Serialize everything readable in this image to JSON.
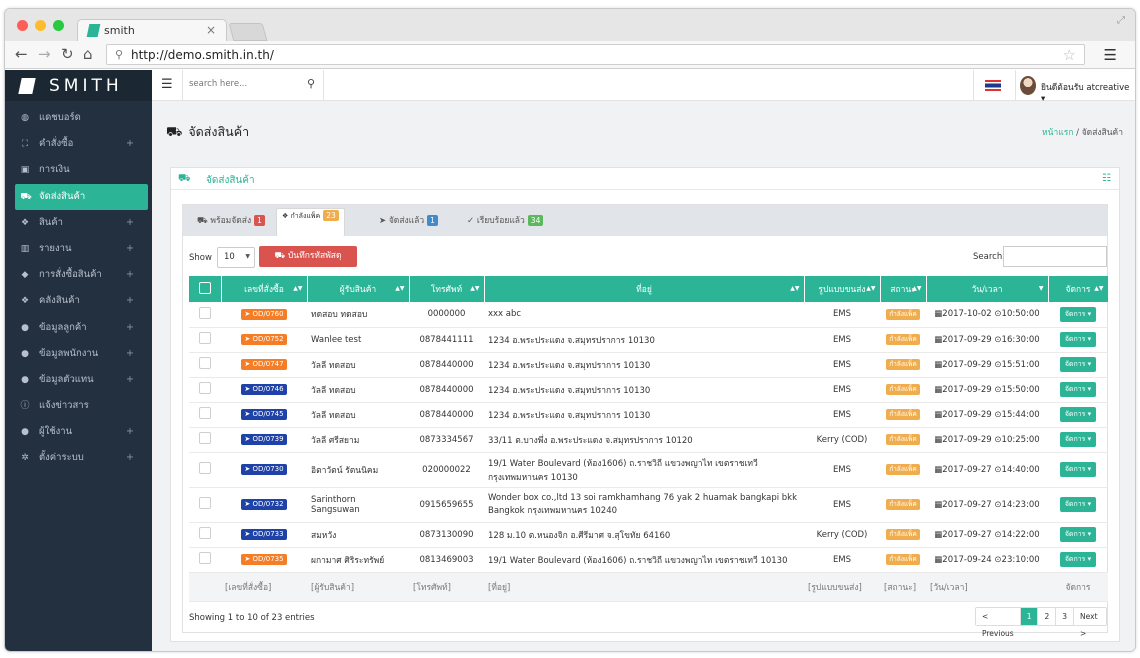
{
  "browser": {
    "tab_title": "smith",
    "tab_close": "×",
    "url": "http://demo.smith.in.th/"
  },
  "sidebar": {
    "brand": "SMITH",
    "items": [
      {
        "label": "แดชบอร์ด",
        "icon": "dashboard-icon",
        "plus": false
      },
      {
        "label": "คำสั่งซื้อ",
        "icon": "cart-icon",
        "plus": true
      },
      {
        "label": "การเงิน",
        "icon": "money-icon",
        "plus": false
      },
      {
        "label": "จัดส่งสินค้า",
        "icon": "truck-icon",
        "plus": false,
        "active": true
      },
      {
        "label": "สินค้า",
        "icon": "cubes-icon",
        "plus": true
      },
      {
        "label": "รายงาน",
        "icon": "chart-icon",
        "plus": true
      },
      {
        "label": "การสั่งซื้อสินค้า",
        "icon": "tag-icon",
        "plus": true
      },
      {
        "label": "คลังสินค้า",
        "icon": "cubes-icon",
        "plus": true
      },
      {
        "label": "ข้อมูลลูกค้า",
        "icon": "users-icon",
        "plus": true
      },
      {
        "label": "ข้อมูลพนักงาน",
        "icon": "users-icon",
        "plus": true
      },
      {
        "label": "ข้อมูลตัวแทน",
        "icon": "users-icon",
        "plus": true
      },
      {
        "label": "แจ้งข่าวสาร",
        "icon": "info-icon",
        "plus": false
      },
      {
        "label": "ผู้ใช้งาน",
        "icon": "users-icon",
        "plus": true
      },
      {
        "label": "ตั้งค่าระบบ",
        "icon": "gear-icon",
        "plus": true
      }
    ]
  },
  "topbar": {
    "search_placeholder": "search here...",
    "user_name": "ยินดีต้อนรับ atcreative"
  },
  "page": {
    "title": "จัดส่งสินค้า",
    "breadcrumb_home": "หน้าแรก",
    "breadcrumb_sep": "/",
    "breadcrumb_current": "จัดส่งสินค้า",
    "panel_title": "จัดส่งสินค้า"
  },
  "tabs": [
    {
      "label": "พร้อมจัดส่ง",
      "count": "1",
      "color": "#d9534f"
    },
    {
      "label": "กำลังแพ็ค",
      "count": "23",
      "color": "#f0ad4e"
    },
    {
      "label": "จัดส่งแล้ว",
      "count": "1",
      "color": "#428bca"
    },
    {
      "label": "เรียบร้อยแล้ว",
      "count": "34",
      "color": "#5cb85c"
    }
  ],
  "controls": {
    "show_label": "Show",
    "page_size": "10",
    "record_button": "บันทึกรหัสพัสดุ",
    "search_label": "Search"
  },
  "table": {
    "headers": [
      "เลขที่สั่งซื้อ",
      "ผู้รับสินค้า",
      "โทรศัพท์",
      "ที่อยู่",
      "รูปแบบขนส่ง",
      "สถานะ",
      "วัน/เวลา",
      "จัดการ"
    ],
    "rows": [
      {
        "order": "OD/0760",
        "c": "o",
        "recipient": "ทดสอบ ทดสอบ",
        "phone": "0000000",
        "address": "xxx abc",
        "ship": "EMS",
        "status": "กำลังแพ็ค",
        "date": "2017-10-02",
        "time": "10:50:00"
      },
      {
        "order": "OD/0752",
        "c": "o",
        "recipient": "Wanlee test",
        "phone": "0878441111",
        "address": "1234 อ.พระประแดง จ.สมุทรปราการ 10130",
        "ship": "EMS",
        "status": "กำลังแพ็ค",
        "date": "2017-09-29",
        "time": "16:30:00"
      },
      {
        "order": "OD/0747",
        "c": "o",
        "recipient": "วัลลี ทดสอบ",
        "phone": "0878440000",
        "address": "1234 อ.พระประแดง จ.สมุทปราการ 10130",
        "ship": "EMS",
        "status": "กำลังแพ็ค",
        "date": "2017-09-29",
        "time": "15:51:00"
      },
      {
        "order": "OD/0746",
        "c": "b",
        "recipient": "วัลลี ทดสอบ",
        "phone": "0878440000",
        "address": "1234 อ.พระประแดง จ.สมุทปราการ 10130",
        "ship": "EMS",
        "status": "กำลังแพ็ค",
        "date": "2017-09-29",
        "time": "15:50:00"
      },
      {
        "order": "OD/0745",
        "c": "b",
        "recipient": "วัลลี ทดสอบ",
        "phone": "0878440000",
        "address": "1234 อ.พระประแดง จ.สมุทปราการ 10130",
        "ship": "EMS",
        "status": "กำลังแพ็ค",
        "date": "2017-09-29",
        "time": "15:44:00"
      },
      {
        "order": "OD/0739",
        "c": "b",
        "recipient": "วัลลี ศรีสยาม",
        "phone": "0873334567",
        "address": "33/11 ต.บางพึ่ง อ.พระประแดง จ.สมุทรปราการ 10120",
        "ship": "Kerry (COD)",
        "status": "กำลังแพ็ค",
        "date": "2017-09-29",
        "time": "10:25:00"
      },
      {
        "order": "OD/0730",
        "c": "b",
        "recipient": "อิตาวัตน์ รัตนนิคม",
        "phone": "020000022",
        "address": "19/1 Water Boulevard (ห้อง1606) ถ.ราชวิถี แขวงพญาไท เขตราชเทวี กรุงเทพมหานคร 10130",
        "ship": "EMS",
        "status": "กำลังแพ็ค",
        "date": "2017-09-27",
        "time": "14:40:00",
        "tall": true
      },
      {
        "order": "OD/0732",
        "c": "b",
        "recipient": "Sarinthorn Sangsuwan",
        "phone": "0915659655",
        "address": "Wonder box co.,ltd 13 soi ramkhamhang 76 yak 2 huamak bangkapi bkk Bangkok กรุงเทพมหานคร 10240",
        "ship": "EMS",
        "status": "กำลังแพ็ค",
        "date": "2017-09-27",
        "time": "14:23:00",
        "tall": true
      },
      {
        "order": "OD/0733",
        "c": "b",
        "recipient": "สมหวัง",
        "phone": "0873130090",
        "address": "128 ม.10 ต.หนองจิก อ.ศีรีมาศ จ.สุโขทัย 64160",
        "ship": "Kerry (COD)",
        "status": "กำลังแพ็ค",
        "date": "2017-09-27",
        "time": "14:22:00"
      },
      {
        "order": "OD/0735",
        "c": "o",
        "recipient": "ผกามาศ ศิริระทรัพย์",
        "phone": "0813469003",
        "address": "19/1 Water Boulevard (ห้อง1606) ถ.ราชวิถี แขวงพญาไท เขตราชเทวี 10130",
        "ship": "EMS",
        "status": "กำลังแพ็ค",
        "date": "2017-09-24",
        "time": "23:10:00"
      }
    ],
    "action_label": "จัดการ",
    "footer": [
      "[เลขที่สั่งซื้อ]",
      "[ผู้รับสินค้า]",
      "[โทรศัพท์]",
      "[ที่อยู่]",
      "[รูปแบบขนส่ง]",
      "[สถานะ]",
      "[วัน/เวลา]",
      "จัดการ"
    ]
  },
  "pagination": {
    "info": "Showing 1 to 10 of 23 entries",
    "prev": "< Previous",
    "pages": [
      "1",
      "2",
      "3"
    ],
    "next": "Next >"
  },
  "colors": {
    "accent": "#2bb596",
    "sidebar": "#23303f",
    "danger": "#d9534f",
    "warning": "#f0ad4e",
    "order_orange": "#f57d25",
    "order_blue": "#1f42a8"
  }
}
